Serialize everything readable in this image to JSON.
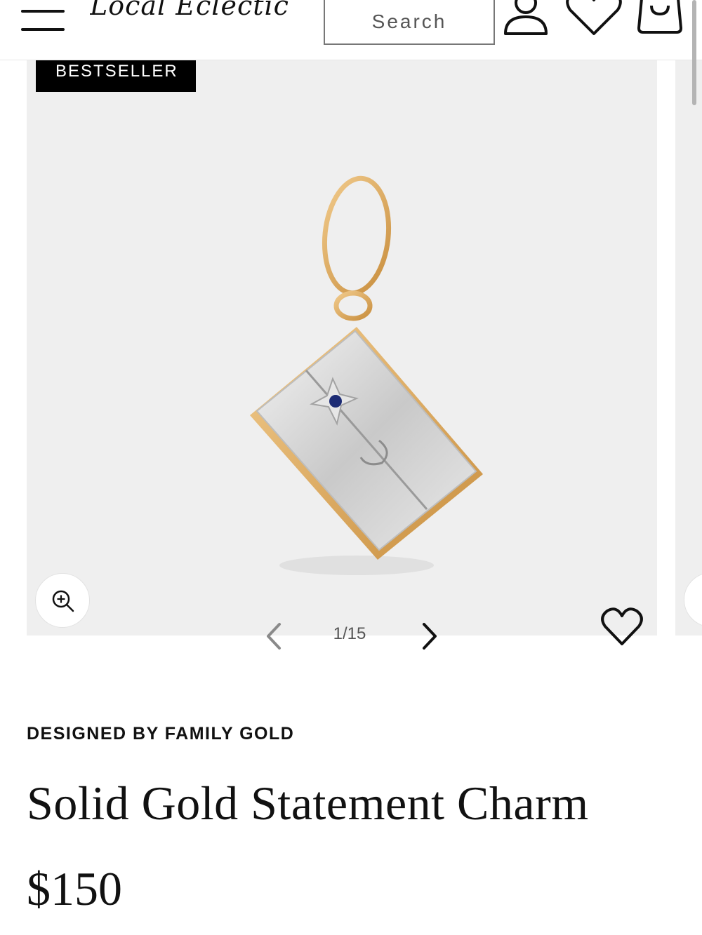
{
  "header": {
    "logo_text": "Local Eclectic",
    "search_placeholder": "Search"
  },
  "icons": {
    "menu": "menu-icon",
    "account": "account-icon",
    "wishlist": "heart-icon",
    "bag": "shopping-bag-icon",
    "zoom": "zoom-in-icon",
    "prev": "chevron-left-icon",
    "next": "chevron-right-icon",
    "favorite": "heart-icon"
  },
  "gallery": {
    "badge": "BESTSELLER",
    "counter": "1/15",
    "background": "#efefef"
  },
  "product": {
    "designer": "DESIGNED BY FAMILY GOLD",
    "title": "Solid Gold Statement Charm",
    "price": "$150"
  }
}
